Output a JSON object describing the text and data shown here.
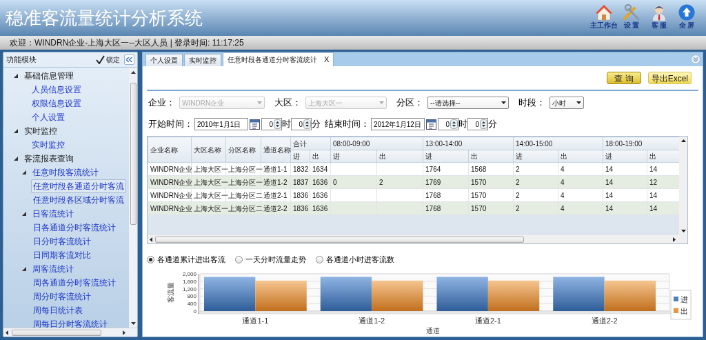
{
  "header": {
    "title": "稳准客流量统计分析系统",
    "toolbar": [
      {
        "kind": "home",
        "label": "主工作台"
      },
      {
        "kind": "tools",
        "label": "设 置"
      },
      {
        "kind": "person",
        "label": "客 服"
      },
      {
        "kind": "up",
        "label": "全 屏"
      }
    ]
  },
  "status_bar": {
    "text": "欢迎：WINDRN企业-上海大区一--大区人员 | 登录时间: 11:17:25"
  },
  "sidebar": {
    "title": "功能模块",
    "lock": {
      "label": "锁定",
      "checked": true
    },
    "items": [
      {
        "label": "基础信息管理",
        "expanded": true,
        "selected": false,
        "children": [
          {
            "label": "人员信息设置",
            "selected": false
          },
          {
            "label": "权限信息设置",
            "selected": false
          },
          {
            "label": "个人设置",
            "selected": false
          }
        ]
      },
      {
        "label": "实时监控",
        "expanded": true,
        "selected": false,
        "children": [
          {
            "label": "实时监控",
            "selected": false
          }
        ]
      },
      {
        "label": "客流报表查询",
        "expanded": true,
        "selected": false,
        "children": [
          {
            "label": "任意时段客流统计",
            "expanded": true,
            "selected": false,
            "children": [
              {
                "label": "任意时段各通道分时客流",
                "selected": true
              },
              {
                "label": "任意时段各区域分时客流",
                "selected": false
              }
            ]
          },
          {
            "label": "日客流统计",
            "expanded": true,
            "selected": false,
            "children": [
              {
                "label": "日各通道分时客流统计",
                "selected": false
              },
              {
                "label": "日分时客流统计",
                "selected": false
              },
              {
                "label": "日同期客流对比",
                "selected": false
              }
            ]
          },
          {
            "label": "周客流统计",
            "expanded": true,
            "selected": false,
            "children": [
              {
                "label": "周各通道分时客流统计",
                "selected": false
              },
              {
                "label": "周分时客流统计",
                "selected": false
              },
              {
                "label": "周每日统计表",
                "selected": false
              },
              {
                "label": "周每日分时客流统计",
                "selected": false
              }
            ]
          }
        ]
      }
    ]
  },
  "tabs": [
    {
      "label": "个人设置",
      "selected": false,
      "closable": false
    },
    {
      "label": "实时监控",
      "selected": false,
      "closable": false
    },
    {
      "label": "任意时段各通道分时客流统计",
      "selected": true,
      "closable": true,
      "close_label": "X"
    }
  ],
  "buttons": [
    {
      "label": "查 询"
    },
    {
      "label": "导出Excel"
    }
  ],
  "filters": [
    {
      "label": "企业：",
      "value": "WINDRN企业",
      "disabled": true
    },
    {
      "label": "大区：",
      "value": "上海大区一",
      "disabled": true
    },
    {
      "label": "分区：",
      "value": "--请选择--",
      "disabled": false
    },
    {
      "label": "时段：",
      "value": "小时",
      "disabled": false
    }
  ],
  "time_range": [
    {
      "label": "开始时间：",
      "date": "2010年1月1日",
      "hour": "0",
      "hour_unit": "时",
      "minute": "0",
      "minute_unit": "分"
    },
    {
      "label": "结束时间：",
      "date": "2012年1月12日",
      "hour": "0",
      "hour_unit": "时",
      "minute": "0",
      "minute_unit": "分"
    }
  ],
  "table": {
    "columns": [
      "企业名称",
      "大区名称",
      "分区名称",
      "通道名称"
    ],
    "groups": [
      {
        "label": "合计",
        "in": "进",
        "out": "出"
      },
      {
        "label": "08:00-09:00",
        "in": "进",
        "out": "出"
      },
      {
        "label": "13:00-14:00",
        "in": "进",
        "out": "出"
      },
      {
        "label": "14:00-15:00",
        "in": "进",
        "out": "出"
      },
      {
        "label": "18:00-19:00",
        "in": "进",
        "out": "出"
      }
    ],
    "rows": [
      [
        "WINDRN企业",
        "上海大区一",
        "上海分区一",
        "通道1-1",
        "1832",
        "1634",
        null,
        null,
        "1764",
        "1568",
        "2",
        "4",
        "14",
        "14"
      ],
      [
        "WINDRN企业",
        "上海大区一",
        "上海分区一",
        "通道1-2",
        "1837",
        "1636",
        "0",
        "2",
        "1769",
        "1570",
        "2",
        "4",
        "14",
        "12"
      ],
      [
        "WINDRN企业",
        "上海大区一",
        "上海分区二",
        "通道2-1",
        "1836",
        "1636",
        null,
        null,
        "1768",
        "1570",
        "2",
        "4",
        "14",
        "14"
      ],
      [
        "WINDRN企业",
        "上海大区一",
        "上海分区二",
        "通道2-2",
        "1836",
        "1636",
        null,
        null,
        "1768",
        "1570",
        "2",
        "4",
        "14",
        "14"
      ]
    ]
  },
  "chart_options": [
    {
      "label": "各通道累计进出客流",
      "selected": true
    },
    {
      "label": "一天分时流量走势",
      "selected": false
    },
    {
      "label": "各通道小时进客流数",
      "selected": false
    }
  ],
  "chart": {
    "chart_data": {
      "type": "bar",
      "xlabel": "通道",
      "ylabel": "客流量",
      "categories": [
        "通道1-1",
        "通道1-2",
        "通道2-1",
        "通道2-2"
      ],
      "series": [
        {
          "name": "进",
          "color": "#4f81bd",
          "values": [
            1832,
            1837,
            1836,
            1836
          ]
        },
        {
          "name": "出",
          "color": "#e8953f",
          "values": [
            1634,
            1636,
            1636,
            1636
          ]
        }
      ],
      "grid": true,
      "legend": "right",
      "ylim": [
        0,
        2000
      ],
      "yticks": [
        0,
        400,
        800,
        {
          "value": 1200,
          "label": "1,200"
        },
        {
          "value": 1600,
          "label": "1,600"
        },
        {
          "value": 2000,
          "label": "2,000"
        }
      ]
    }
  }
}
